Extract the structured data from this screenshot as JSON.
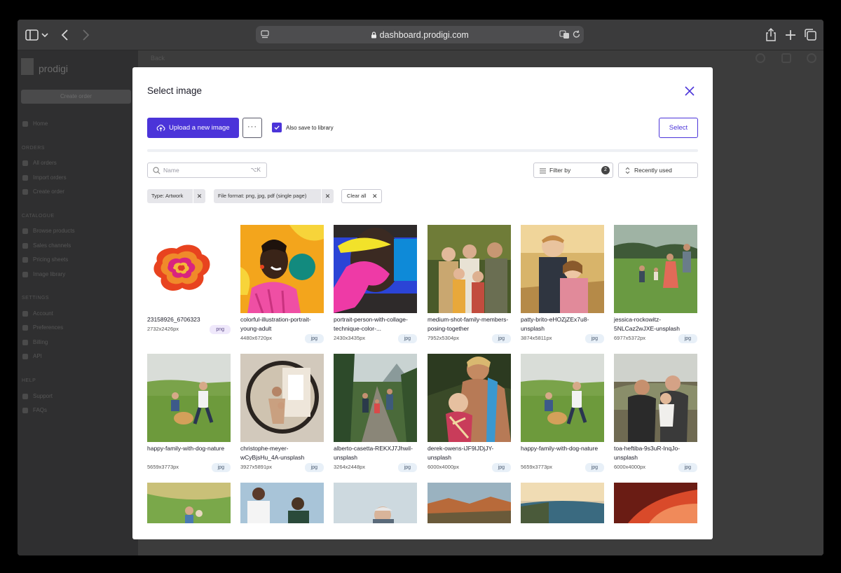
{
  "browser": {
    "url": "dashboard.prodigi.com"
  },
  "background": {
    "brand": "prodigi",
    "create_order": "Create order",
    "back": "Back",
    "sections": [
      {
        "title": "ORDERS",
        "items": [
          "All orders",
          "Import orders",
          "Create order"
        ]
      },
      {
        "title": "CATALOGUE",
        "items": [
          "Browse products",
          "Sales channels",
          "Pricing sheets",
          "Image library"
        ]
      },
      {
        "title": "SETTINGS",
        "items": [
          "Account",
          "Preferences",
          "Billing",
          "API"
        ]
      },
      {
        "title": "HELP",
        "items": [
          "Support",
          "FAQs"
        ]
      }
    ],
    "home": "Home"
  },
  "modal": {
    "title": "Select image",
    "upload_label": "Upload a new image",
    "more_label": "···",
    "also_save_label": "Also save to library",
    "select_label": "Select",
    "search_placeholder": "Name",
    "search_shortcut": "⌥K",
    "filter_label": "Filter by",
    "filter_count": "2",
    "sort_label": "Recently used",
    "chips": [
      {
        "label": "Type: Artwork"
      },
      {
        "label": "File format: png, jpg, pdf (single page)"
      }
    ],
    "clear_all": "Clear all",
    "images": [
      {
        "name": "23158926_6706323",
        "size": "2732x2426px",
        "format": "png"
      },
      {
        "name": "colorful-illustration-portrait-young-adult",
        "size": "4480x6720px",
        "format": "jpg"
      },
      {
        "name": "portrait-person-with-collage-technique-color-...",
        "size": "2430x3435px",
        "format": "jpg"
      },
      {
        "name": "medium-shot-family-members-posing-together",
        "size": "7952x5304px",
        "format": "jpg"
      },
      {
        "name": "patty-brito-eHOZjZEx7u8-unsplash",
        "size": "3874x5811px",
        "format": "jpg"
      },
      {
        "name": "jessica-rockowitz-5NLCaz2wJXE-unsplash",
        "size": "6977x5372px",
        "format": "jpg"
      },
      {
        "name": "happy-family-with-dog-nature",
        "size": "5659x3773px",
        "format": "jpg"
      },
      {
        "name": "christophe-meyer-wCyBjsHu_4A-unsplash",
        "size": "3927x5891px",
        "format": "jpg"
      },
      {
        "name": "alberto-casetta-REKXJ7Jhwil-unsplash",
        "size": "3264x2448px",
        "format": "jpg"
      },
      {
        "name": "derek-owens-iJF9IJDjJY-unsplash",
        "size": "6000x4000px",
        "format": "jpg"
      },
      {
        "name": "happy-family-with-dog-nature",
        "size": "5659x3773px",
        "format": "jpg"
      },
      {
        "name": "toa-heftiba-9s3uR-InqJo-unsplash",
        "size": "6000x4000px",
        "format": "jpg"
      }
    ]
  }
}
